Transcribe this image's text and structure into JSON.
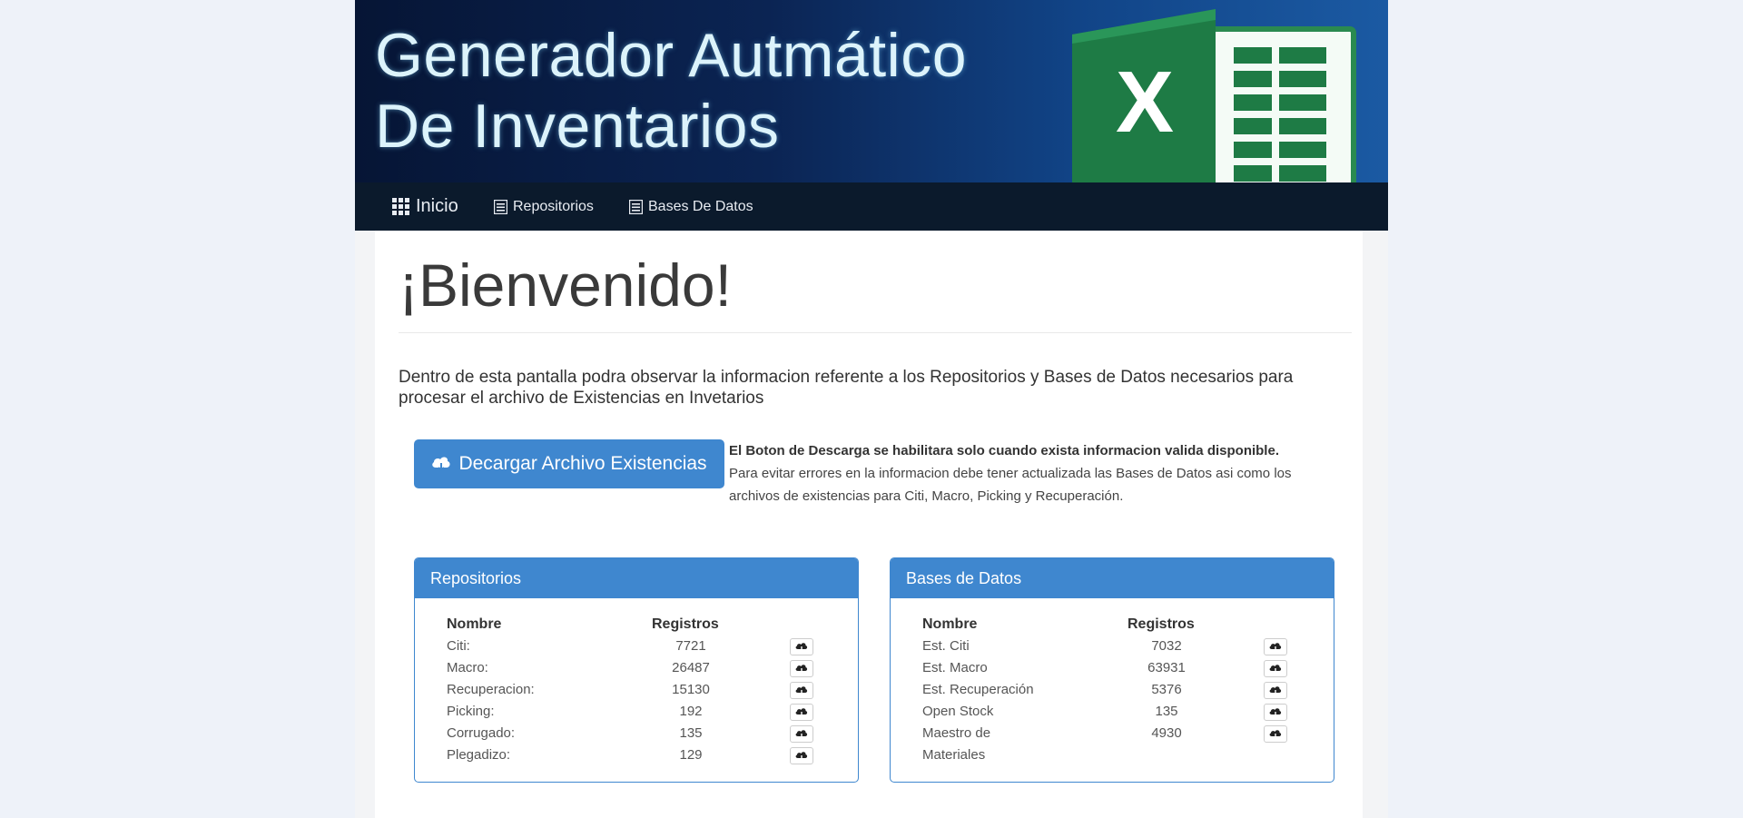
{
  "header": {
    "title_line1": "Generador Autmático",
    "title_line2": "De Inventarios",
    "logo_icon": "excel-logo-icon"
  },
  "nav": {
    "home_label": "Inicio",
    "repos_label": "Repositorios",
    "db_label": "Bases De Datos"
  },
  "main": {
    "welcome": "¡Bienvenido!",
    "intro": "Dentro de esta pantalla podra observar la informacion referente a los Repositorios y Bases de Datos necesarios para procesar el archivo de Existencias en Invetarios",
    "download_button": "Decargar Archivo Existencias",
    "notice_bold": "El Boton de Descarga se habilitara solo cuando exista informacion valida disponible.",
    "notice_text": "Para evitar errores en la informacion debe tener actualizada las Bases de Datos asi como los archivos de existencias para Citi, Macro, Picking y Recuperación."
  },
  "repositorios": {
    "title": "Repositorios",
    "col_name": "Nombre",
    "col_records": "Registros",
    "rows": [
      {
        "name": "Citi:",
        "records": "7721"
      },
      {
        "name": "Macro:",
        "records": "26487"
      },
      {
        "name": "Recuperacion:",
        "records": "15130"
      },
      {
        "name": "Picking:",
        "records": "192"
      },
      {
        "name": "Corrugado:",
        "records": "135"
      },
      {
        "name": "Plegadizo:",
        "records": "129"
      }
    ]
  },
  "bases": {
    "title": "Bases de Datos",
    "col_name": "Nombre",
    "col_records": "Registros",
    "rows": [
      {
        "name": "Est. Citi",
        "records": "7032"
      },
      {
        "name": "Est. Macro",
        "records": "63931"
      },
      {
        "name": "Est. Recuperación",
        "records": "5376"
      },
      {
        "name": "Open Stock",
        "records": "135"
      },
      {
        "name": "Maestro de",
        "records": "4930"
      },
      {
        "name": "Materiales",
        "records": ""
      }
    ]
  },
  "colors": {
    "primary": "#3f87cf",
    "navbar": "#0b1a2c",
    "excel_green": "#1e7b45"
  }
}
